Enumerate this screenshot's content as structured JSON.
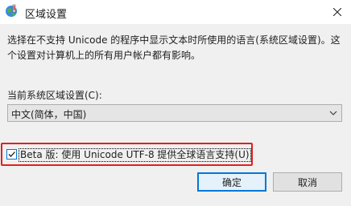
{
  "window": {
    "title": "区域设置",
    "icon": "region-globe-icon",
    "close_icon": "close-icon"
  },
  "description": {
    "line1": "选择在不支持 Unicode 的程序中显示文本时所使用的语言(系统区域设置)。这",
    "line2": "个设置对计算机上的所有用户帐户都有影响。"
  },
  "current_locale": {
    "label": "当前系统区域设置(C):",
    "selected": "中文(简体，中国)"
  },
  "beta_option": {
    "label": "Beta 版: 使用 Unicode UTF-8 提供全球语言支持(U)",
    "checked": true,
    "highlight_color": "#e02020"
  },
  "buttons": {
    "ok": "确定",
    "cancel": "取消"
  },
  "colors": {
    "accent": "#0078d7",
    "dialog_bg": "#f0f0f0"
  }
}
